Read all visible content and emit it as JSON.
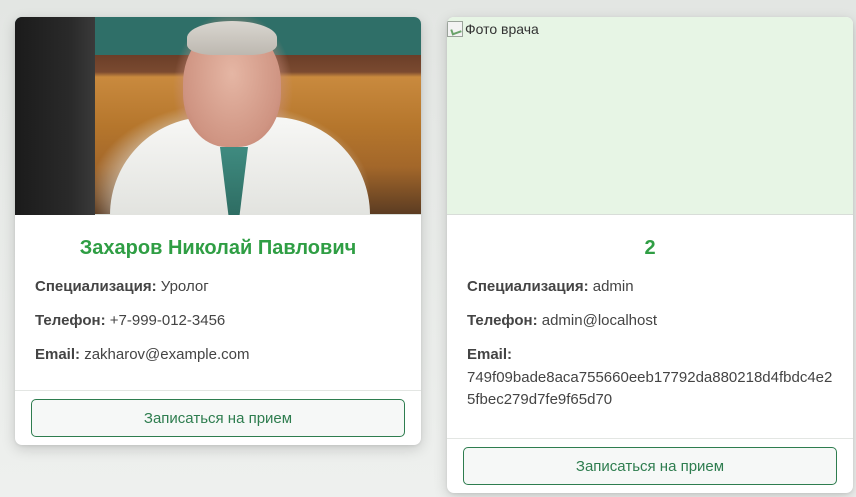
{
  "doctors": [
    {
      "name": "Захаров Николай Павлович",
      "specialization_label": "Специализация:",
      "specialization": "Уролог",
      "phone_label": "Телефон:",
      "phone": "+7-999-012-3456",
      "email_label": "Email:",
      "email": "zakharov@example.com",
      "button_label": "Записаться на прием"
    },
    {
      "photo_alt": "Фото врача",
      "name": "2",
      "specialization_label": "Специализация:",
      "specialization": "admin",
      "phone_label": "Телефон:",
      "phone": "admin@localhost",
      "email_label": "Email:",
      "email": "749f09bade8aca755660eeb17792da880218d4fbdc4e25fbec279d7fe9f65d70",
      "button_label": "Записаться на прием"
    }
  ],
  "colors": {
    "accent": "#2f9e44",
    "button_border": "#2e7d4f",
    "broken_photo_bg": "#e7f5e5"
  }
}
